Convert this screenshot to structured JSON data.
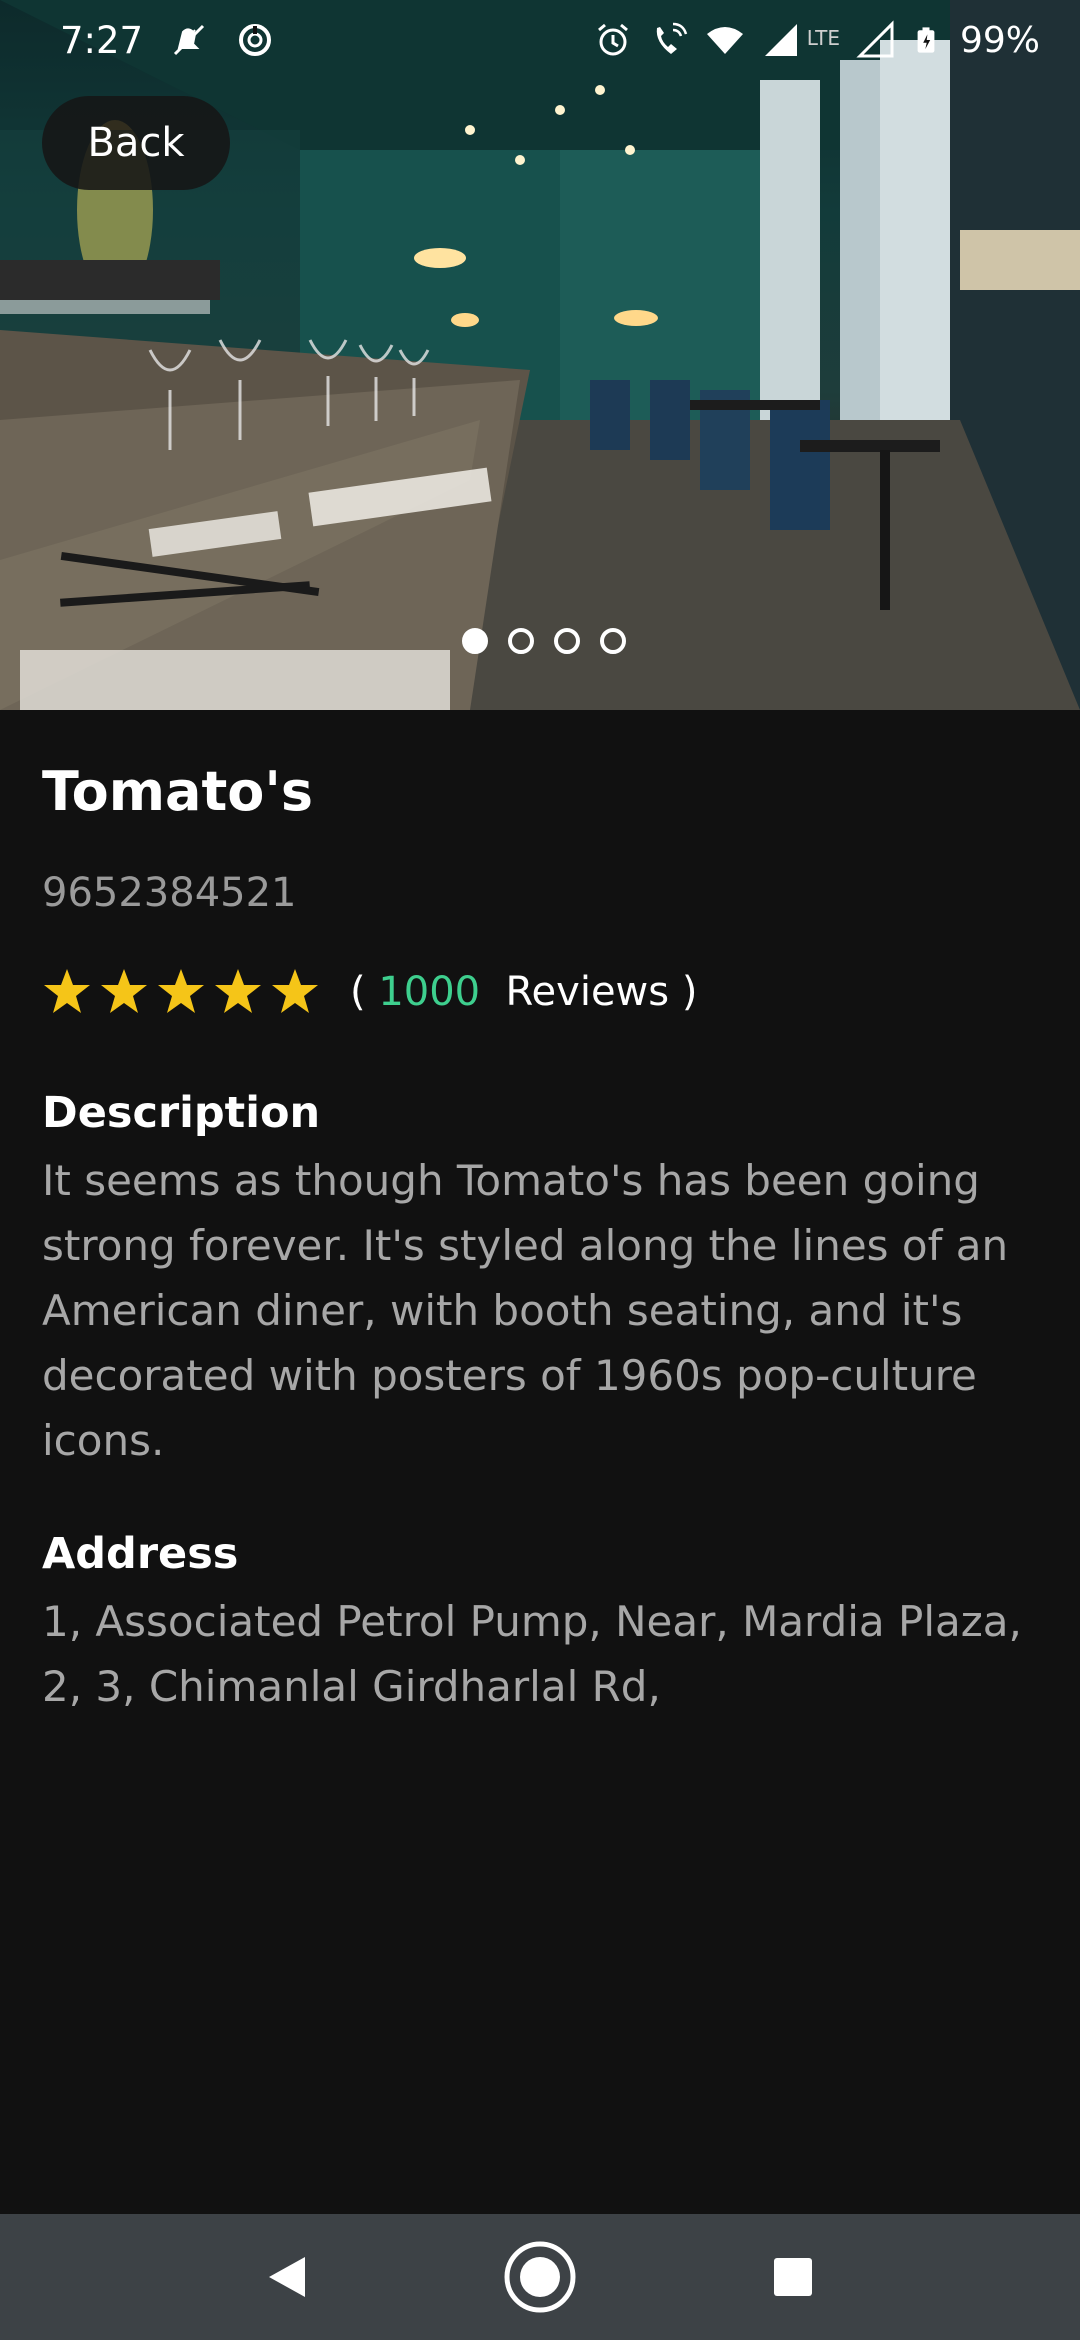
{
  "status_bar": {
    "time": "7:27",
    "battery": "99%",
    "network": "LTE",
    "icons": [
      "mute-icon",
      "data-saver-icon",
      "alarm-icon",
      "wifi-call-icon",
      "wifi-icon",
      "signal-icon",
      "battery-icon"
    ]
  },
  "hero": {
    "back_label": "Back",
    "carousel": {
      "count": 4,
      "active_index": 0
    }
  },
  "restaurant": {
    "name": "Tomato's",
    "phone": "9652384521",
    "rating": 5,
    "review_prefix": "( ",
    "review_count": "1000",
    "review_suffix": "  Reviews )",
    "star_color": "#f5c518"
  },
  "description": {
    "heading": "Description",
    "text": "It seems as though Tomato's has been going strong forever. It's styled along the lines of an American diner, with booth seating, and it's decorated with posters of 1960s pop-culture icons."
  },
  "address": {
    "heading": "Address",
    "text": "1, Associated Petrol Pump, Near, Mardia Plaza, 2, 3, Chimanlal Girdharlal Rd,"
  },
  "colors": {
    "background": "#111111",
    "accent_count": "#3ecf8e",
    "nav_bar": "#3d4246"
  },
  "nav": [
    "back-icon",
    "home-icon",
    "recents-icon"
  ]
}
